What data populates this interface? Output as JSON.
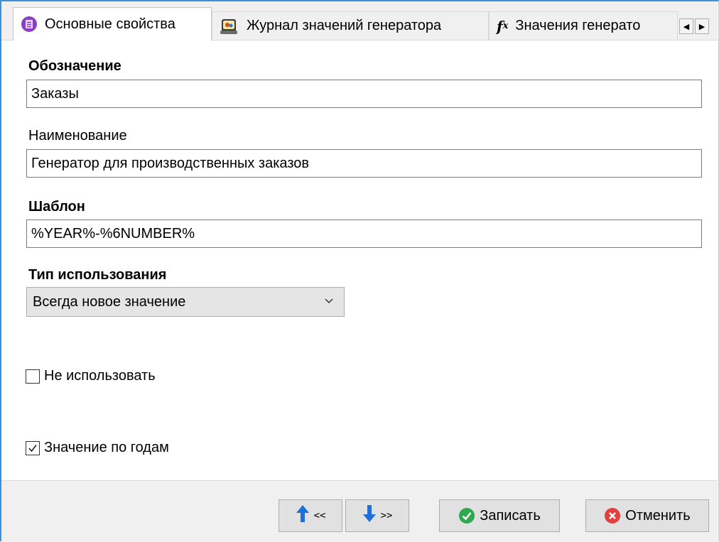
{
  "tabs": [
    {
      "label": "Основные свойства",
      "icon": "properties-icon",
      "active": true
    },
    {
      "label": "Журнал значений генератора",
      "icon": "journal-icon",
      "active": false
    },
    {
      "label": "Значения генерато",
      "icon": "function-icon",
      "active": false
    }
  ],
  "form": {
    "designation_label": "Обозначение",
    "designation_value": "Заказы",
    "name_label": "Наименование",
    "name_value": "Генератор для производственных заказов",
    "template_label": "Шаблон",
    "template_value": "%YEAR%-%6NUMBER%",
    "usage_type_label": "Тип использования",
    "usage_type_value": "Всегда новое значение",
    "do_not_use_label": "Не использовать",
    "do_not_use_checked": false,
    "by_years_label": "Значение по годам",
    "by_years_checked": true
  },
  "footer": {
    "prev_label": "<<",
    "next_label": ">>",
    "save_label": "Записать",
    "cancel_label": "Отменить"
  },
  "colors": {
    "accent_border": "#3c8fd8",
    "tab_icon_purple": "#8a3fc4",
    "arrow_blue": "#1f6fd8",
    "save_green": "#2fa84f",
    "cancel_red": "#e04040"
  }
}
